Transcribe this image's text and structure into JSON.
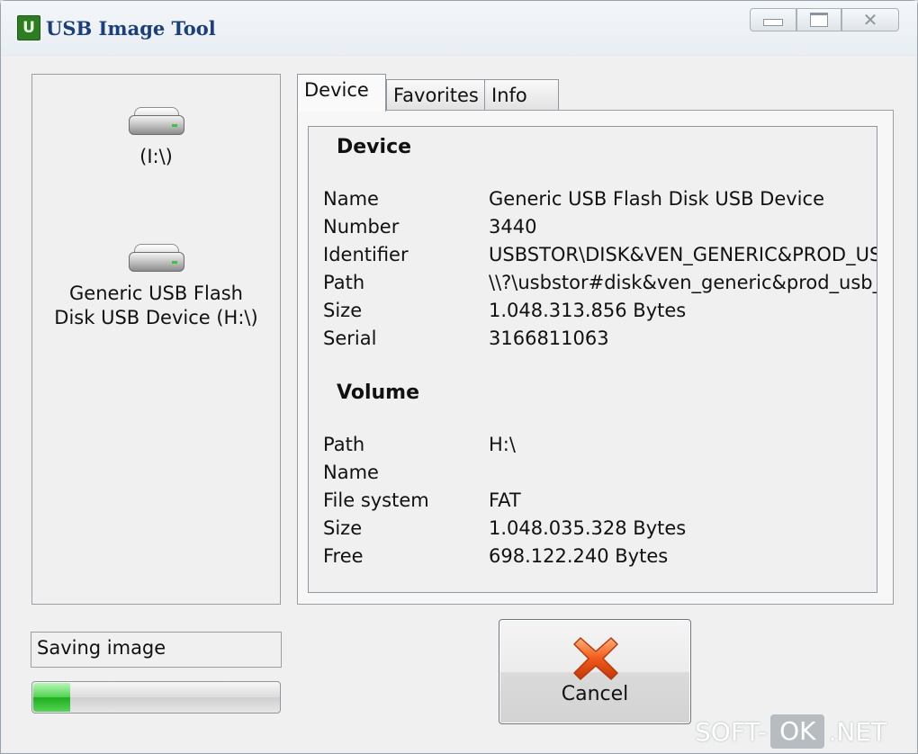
{
  "window": {
    "title": "USB Image Tool",
    "app_icon_letter": "U"
  },
  "devices": [
    {
      "label": "(I:\\)",
      "icon": "usb-drive-icon"
    },
    {
      "label": "Generic USB Flash\nDisk USB Device (H:\\)",
      "icon": "usb-drive-icon"
    }
  ],
  "tabs": [
    {
      "label": "Device",
      "active": true
    },
    {
      "label": "Favorites",
      "active": false
    },
    {
      "label": "Info",
      "active": false
    }
  ],
  "device_section": {
    "title": "Device",
    "rows": [
      {
        "label": "Name",
        "value": "Generic USB Flash Disk USB Device"
      },
      {
        "label": "Number",
        "value": "3440"
      },
      {
        "label": "Identifier",
        "value": "USBSTOR\\DISK&VEN_GENERIC&PROD_USB_FLASH_DISK"
      },
      {
        "label": "Path",
        "value": "\\\\?\\usbstor#disk&ven_generic&prod_usb_flash_disk"
      },
      {
        "label": "Size",
        "value": "1.048.313.856 Bytes"
      },
      {
        "label": "Serial",
        "value": "3166811063"
      }
    ]
  },
  "volume_section": {
    "title": "Volume",
    "rows": [
      {
        "label": "Path",
        "value": "H:\\"
      },
      {
        "label": "Name",
        "value": ""
      },
      {
        "label": "File system",
        "value": "FAT"
      },
      {
        "label": "Size",
        "value": "1.048.035.328 Bytes"
      },
      {
        "label": "Free",
        "value": "698.122.240 Bytes"
      }
    ]
  },
  "status": {
    "text": "Saving image",
    "progress_fraction": 0.15
  },
  "cancel_button": {
    "label": "Cancel",
    "icon": "cancel-x-icon"
  },
  "watermark": {
    "left": "SOFT-",
    "middle": "OK",
    "right": ".NET"
  },
  "colors": {
    "title_text": "#1b3f7a",
    "progress_green": "#2fbf2f",
    "cancel_x": "#f05a1a"
  }
}
